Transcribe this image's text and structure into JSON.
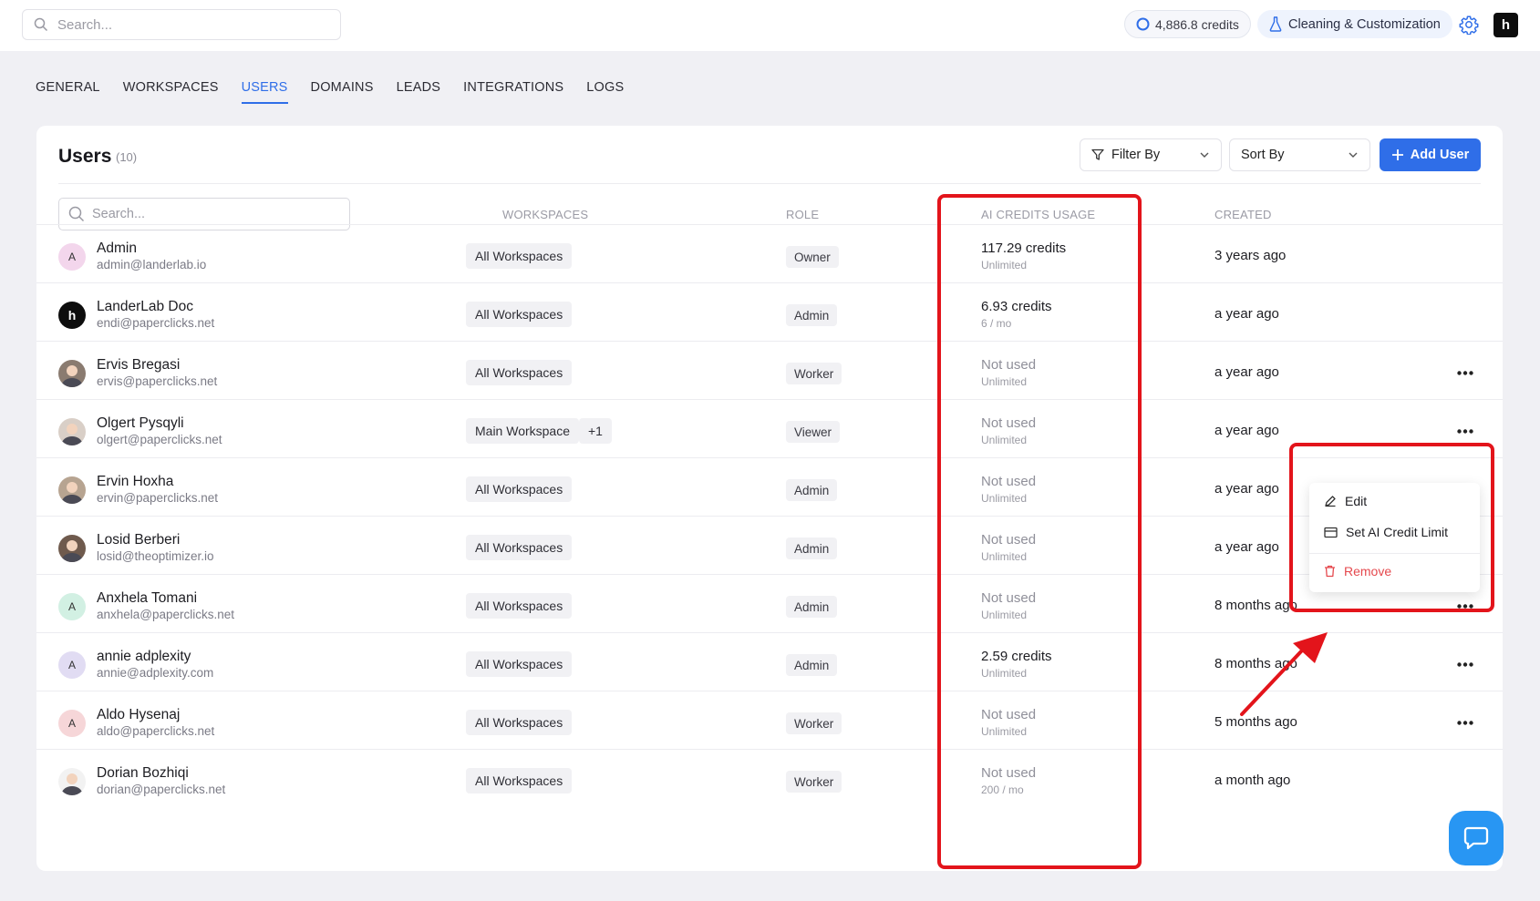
{
  "topbar": {
    "search_placeholder": "Search...",
    "credits": "4,886.8 credits",
    "workspace": "Cleaning & Customization",
    "logo_letter": "h"
  },
  "tabs": [
    {
      "label": "GENERAL",
      "active": false
    },
    {
      "label": "WORKSPACES",
      "active": false
    },
    {
      "label": "USERS",
      "active": true
    },
    {
      "label": "DOMAINS",
      "active": false
    },
    {
      "label": "LEADS",
      "active": false
    },
    {
      "label": "INTEGRATIONS",
      "active": false
    },
    {
      "label": "LOGS",
      "active": false
    }
  ],
  "card": {
    "title": "Users",
    "count": "(10)",
    "filter_label": "Filter By",
    "sort_label": "Sort By",
    "add_label": "Add User",
    "search_placeholder": "Search..."
  },
  "columns": {
    "workspaces": "WORKSPACES",
    "role": "ROLE",
    "credits": "AI CREDITS USAGE",
    "created": "CREATED"
  },
  "users": [
    {
      "name": "Admin",
      "email": "admin@landerlab.io",
      "avatar": "A",
      "avatar_bg": "#f3d6ec",
      "workspace": "All Workspaces",
      "role": "Owner",
      "credits": "117.29 credits",
      "limit": "Unlimited",
      "created": "3 years ago",
      "has_more": false
    },
    {
      "name": "LanderLab Doc",
      "email": "endi@paperclicks.net",
      "avatar": "h",
      "avatar_bg": "#0d0d0d",
      "workspace": "All Workspaces",
      "role": "Admin",
      "credits": "6.93 credits",
      "limit": "6 / mo",
      "created": "a year ago",
      "has_more": false
    },
    {
      "name": "Ervis Bregasi",
      "email": "ervis@paperclicks.net",
      "avatar": "",
      "avatar_bg": "#8a7b70",
      "workspace": "All Workspaces",
      "role": "Worker",
      "credits": "Not used",
      "limit": "Unlimited",
      "created": "a year ago",
      "has_more": true
    },
    {
      "name": "Olgert Pysqyli",
      "email": "olgert@paperclicks.net",
      "avatar": "",
      "avatar_bg": "#d9cfc7",
      "workspace": "Main Workspace",
      "extra_ws": "+1",
      "role": "Viewer",
      "credits": "Not used",
      "limit": "Unlimited",
      "created": "a year ago",
      "has_more": true
    },
    {
      "name": "Ervin Hoxha",
      "email": "ervin@paperclicks.net",
      "avatar": "",
      "avatar_bg": "#b7a491",
      "workspace": "All Workspaces",
      "role": "Admin",
      "credits": "Not used",
      "limit": "Unlimited",
      "created": "a year ago",
      "has_more": false
    },
    {
      "name": "Losid Berberi",
      "email": "losid@theoptimizer.io",
      "avatar": "",
      "avatar_bg": "#6f5a4d",
      "workspace": "All Workspaces",
      "role": "Admin",
      "credits": "Not used",
      "limit": "Unlimited",
      "created": "a year ago",
      "has_more": false
    },
    {
      "name": "Anxhela Tomani",
      "email": "anxhela@paperclicks.net",
      "avatar": "A",
      "avatar_bg": "#d2f0e3",
      "workspace": "All Workspaces",
      "role": "Admin",
      "credits": "Not used",
      "limit": "Unlimited",
      "created": "8 months ago",
      "has_more": true
    },
    {
      "name": "annie adplexity",
      "email": "annie@adplexity.com",
      "avatar": "A",
      "avatar_bg": "#e1dcf3",
      "workspace": "All Workspaces",
      "role": "Admin",
      "credits": "2.59 credits",
      "limit": "Unlimited",
      "created": "8 months ago",
      "has_more": true
    },
    {
      "name": "Aldo Hysenaj",
      "email": "aldo@paperclicks.net",
      "avatar": "A",
      "avatar_bg": "#f6d6d8",
      "workspace": "All Workspaces",
      "role": "Worker",
      "credits": "Not used",
      "limit": "Unlimited",
      "created": "5 months ago",
      "has_more": true
    },
    {
      "name": "Dorian Bozhiqi",
      "email": "dorian@paperclicks.net",
      "avatar": "",
      "avatar_bg": "#f2f2f2",
      "workspace": "All Workspaces",
      "role": "Worker",
      "credits": "Not used",
      "limit": "200 / mo",
      "created": "a month ago",
      "has_more": false
    }
  ],
  "menu": {
    "edit": "Edit",
    "set_limit": "Set AI Credit Limit",
    "remove": "Remove"
  },
  "colors": {
    "accent": "#2f6ee8",
    "annotation": "#e3141b",
    "danger": "#e5484d",
    "chat": "#2896f3"
  }
}
